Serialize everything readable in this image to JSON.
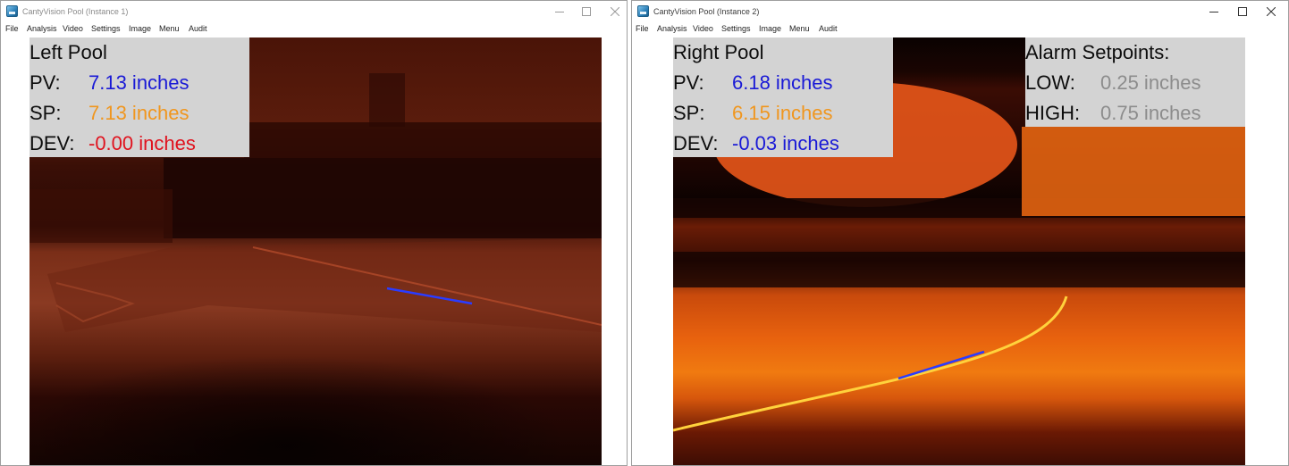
{
  "left_window": {
    "title": "CantyVision Pool (Instance 1)",
    "menu": [
      "File",
      "Analysis",
      "Video",
      "Settings",
      "Image",
      "Menu",
      "Audit"
    ],
    "overlay": {
      "heading": "Left Pool",
      "pv_label": "PV:",
      "pv_value": "7.13 inches",
      "sp_label": "SP:",
      "sp_value": "7.13 inches",
      "dev_label": "DEV:",
      "dev_value": "-0.00 inches"
    }
  },
  "right_window": {
    "title": "CantyVision Pool (Instance 2)",
    "menu": [
      "File",
      "Analysis",
      "Video",
      "Settings",
      "Image",
      "Menu",
      "Audit"
    ],
    "overlay": {
      "heading": "Right Pool",
      "pv_label": "PV:",
      "pv_value": "6.18 inches",
      "sp_label": "SP:",
      "sp_value": "6.15 inches",
      "dev_label": "DEV:",
      "dev_value": "-0.03 inches"
    },
    "alarm": {
      "heading": "Alarm Setpoints:",
      "low_label": "LOW:",
      "low_value": "0.25 inches",
      "high_label": "HIGH:",
      "high_value": "0.75 inches"
    }
  },
  "icons": {
    "app": "cantyvision-app-icon",
    "minimize": "minimize-icon",
    "maximize": "maximize-icon",
    "close": "close-icon"
  },
  "colors": {
    "pv": "#1a1ad6",
    "sp": "#f0961e",
    "dev_left": "#e0121e",
    "dev_right": "#1a1ad6",
    "alarm_value": "#8c8c8c",
    "overlay_bg": "#d3d3d3",
    "level_line": "#2a3cff"
  }
}
